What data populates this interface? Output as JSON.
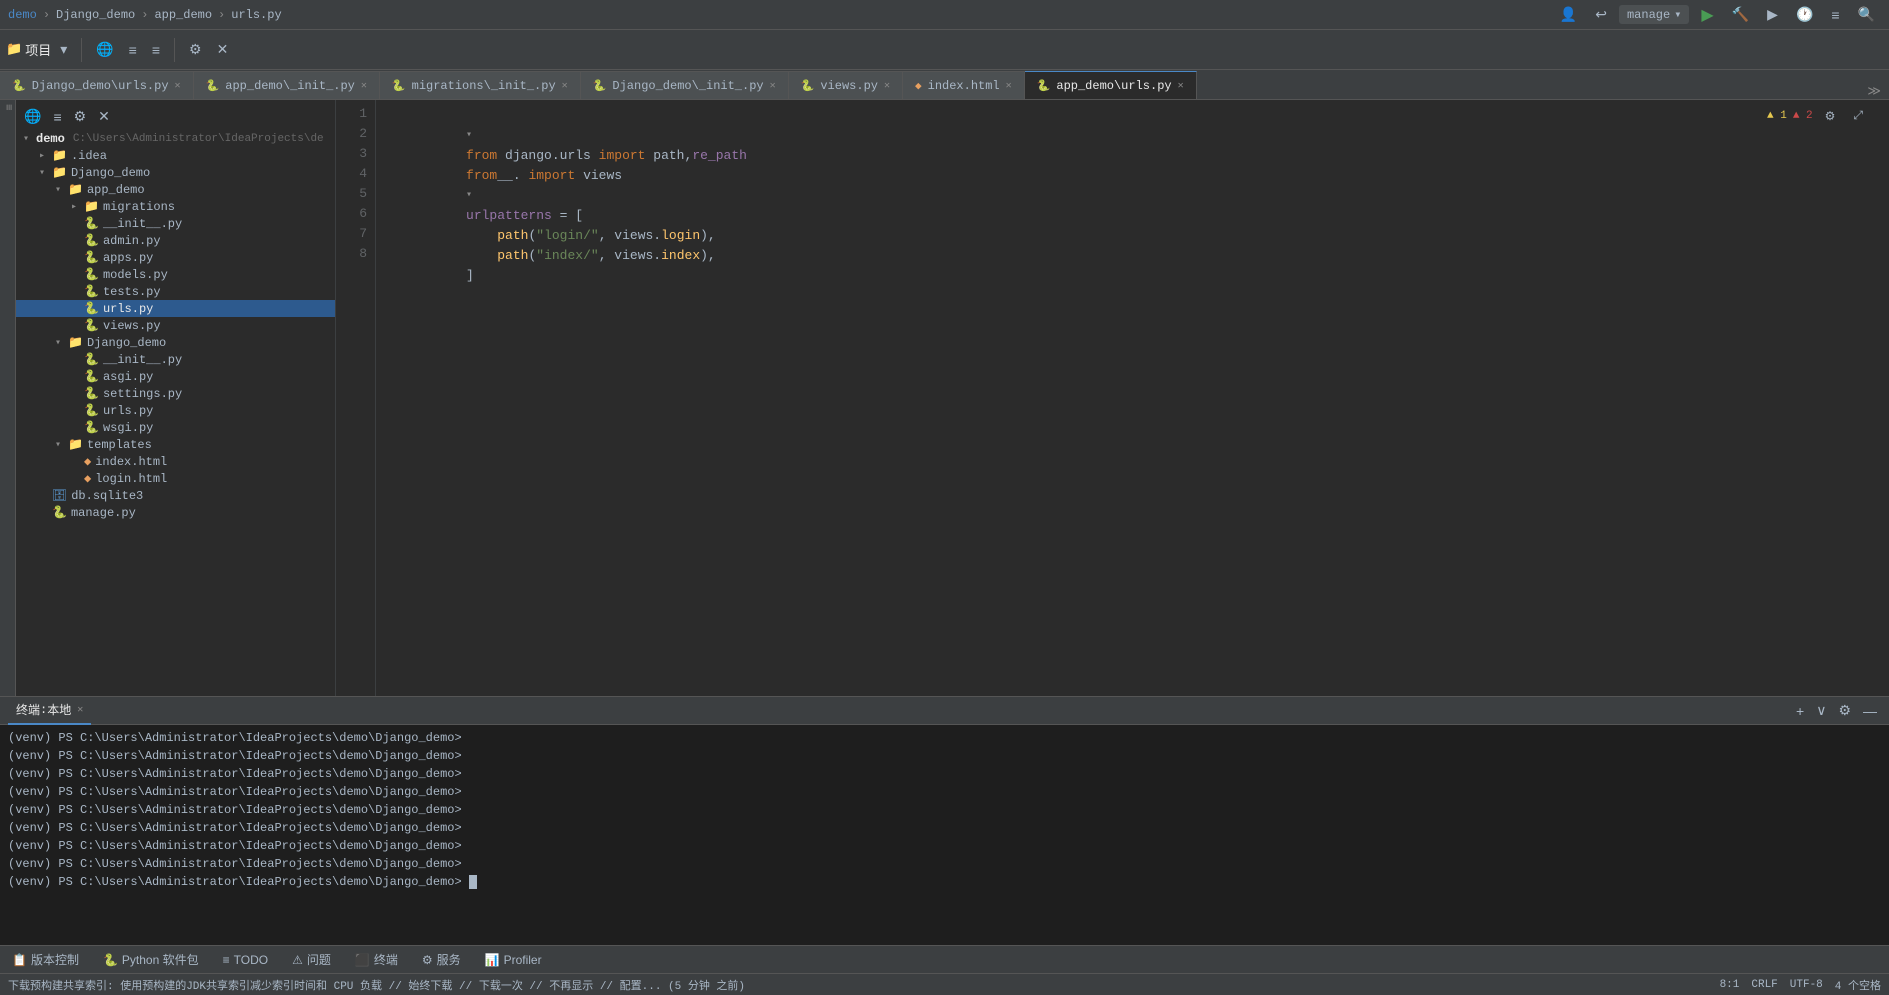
{
  "titlebar": {
    "breadcrumb": [
      "demo",
      "Django_demo",
      "app_demo",
      "urls.py"
    ],
    "manage_label": "manage",
    "search_icon": "🔍"
  },
  "toolbar": {
    "project_label": "项目",
    "run_config": "manage"
  },
  "tabs": [
    {
      "id": "django-urls",
      "icon": "py",
      "label": "Django_demo\\urls.py",
      "active": false
    },
    {
      "id": "app-init",
      "icon": "py",
      "label": "app_demo\\_init_.py",
      "active": false
    },
    {
      "id": "migrations-init",
      "icon": "py",
      "label": "migrations\\_init_.py",
      "active": false
    },
    {
      "id": "django-init",
      "icon": "py",
      "label": "Django_demo\\_init_.py",
      "active": false
    },
    {
      "id": "views",
      "icon": "py",
      "label": "views.py",
      "active": false
    },
    {
      "id": "index-html",
      "icon": "html",
      "label": "index.html",
      "active": false
    },
    {
      "id": "app-urls",
      "icon": "py",
      "label": "app_demo\\urls.py",
      "active": true
    }
  ],
  "file_tree": {
    "root": "demo",
    "root_path": "C:\\Users\\Administrator\\IdeaProjects\\de",
    "items": [
      {
        "id": "idea",
        "level": 1,
        "type": "folder",
        "label": ".idea",
        "expanded": false
      },
      {
        "id": "django-demo",
        "level": 1,
        "type": "folder",
        "label": "Django_demo",
        "expanded": true
      },
      {
        "id": "app-demo",
        "level": 2,
        "type": "folder",
        "label": "app_demo",
        "expanded": true
      },
      {
        "id": "migrations",
        "level": 3,
        "type": "folder",
        "label": "migrations",
        "expanded": false
      },
      {
        "id": "app-init-py",
        "level": 3,
        "type": "py",
        "label": "__init__.py"
      },
      {
        "id": "admin-py",
        "level": 3,
        "type": "py",
        "label": "admin.py"
      },
      {
        "id": "apps-py",
        "level": 3,
        "type": "py",
        "label": "apps.py"
      },
      {
        "id": "models-py",
        "level": 3,
        "type": "py",
        "label": "models.py"
      },
      {
        "id": "tests-py",
        "level": 3,
        "type": "py",
        "label": "tests.py"
      },
      {
        "id": "urls-py",
        "level": 3,
        "type": "py",
        "label": "urls.py",
        "selected": true
      },
      {
        "id": "views-py",
        "level": 3,
        "type": "py",
        "label": "views.py"
      },
      {
        "id": "django-demo-folder",
        "level": 2,
        "type": "folder",
        "label": "Django_demo",
        "expanded": true
      },
      {
        "id": "dj-init-py",
        "level": 3,
        "type": "py",
        "label": "__init__.py"
      },
      {
        "id": "asgi-py",
        "level": 3,
        "type": "py",
        "label": "asgi.py"
      },
      {
        "id": "settings-py",
        "level": 3,
        "type": "py",
        "label": "settings.py"
      },
      {
        "id": "dj-urls-py",
        "level": 3,
        "type": "py",
        "label": "urls.py"
      },
      {
        "id": "wsgi-py",
        "level": 3,
        "type": "py",
        "label": "wsgi.py"
      },
      {
        "id": "templates",
        "level": 2,
        "type": "folder",
        "label": "templates",
        "expanded": true
      },
      {
        "id": "index-html-file",
        "level": 3,
        "type": "html",
        "label": "index.html"
      },
      {
        "id": "login-html-file",
        "level": 3,
        "type": "html",
        "label": "login.html"
      },
      {
        "id": "db-sqlite",
        "level": 1,
        "type": "db",
        "label": "db.sqlite3"
      },
      {
        "id": "manage-py",
        "level": 1,
        "type": "py",
        "label": "manage.py"
      }
    ]
  },
  "editor": {
    "filename": "urls.py",
    "warnings": "▲ 1",
    "errors": "▲ 2",
    "lines": [
      {
        "num": 1,
        "content": "from django.urls import path, re_path",
        "tokens": [
          {
            "text": "from ",
            "class": "kw"
          },
          {
            "text": "django.urls",
            "class": "imp"
          },
          {
            "text": " import ",
            "class": "kw"
          },
          {
            "text": "path, re_path",
            "class": "imp"
          }
        ]
      },
      {
        "num": 2,
        "content": "from__. import views",
        "tokens": [
          {
            "text": "from",
            "class": "kw"
          },
          {
            "text": "__.",
            "class": "imp"
          },
          {
            "text": " import ",
            "class": "kw"
          },
          {
            "text": "views",
            "class": "imp"
          }
        ]
      },
      {
        "num": 3,
        "content": ""
      },
      {
        "num": 4,
        "content": "urlpatterns = [",
        "tokens": [
          {
            "text": "urlpatterns",
            "class": "var"
          },
          {
            "text": " = [",
            "class": "op"
          }
        ]
      },
      {
        "num": 5,
        "content": "    path(\"login/\", views.login),",
        "tokens": [
          {
            "text": "    "
          },
          {
            "text": "path",
            "class": "fn"
          },
          {
            "text": "(",
            "class": "op"
          },
          {
            "text": "\"login/\"",
            "class": "str"
          },
          {
            "text": ", views.",
            "class": "imp"
          },
          {
            "text": "login",
            "class": "fn"
          },
          {
            "text": "),",
            "class": "op"
          }
        ]
      },
      {
        "num": 6,
        "content": "    path(\"index/\", views.index),",
        "tokens": [
          {
            "text": "    "
          },
          {
            "text": "path",
            "class": "fn"
          },
          {
            "text": "(",
            "class": "op"
          },
          {
            "text": "\"index/\"",
            "class": "str"
          },
          {
            "text": ", views.",
            "class": "imp"
          },
          {
            "text": "index",
            "class": "fn"
          },
          {
            "text": "),",
            "class": "op"
          }
        ]
      },
      {
        "num": 7,
        "content": "]"
      },
      {
        "num": 8,
        "content": ""
      }
    ]
  },
  "terminal": {
    "tab_label": "终端",
    "local_label": "本地",
    "lines": [
      "(venv) PS C:\\Users\\Administrator\\IdeaProjects\\demo\\Django_demo>",
      "(venv) PS C:\\Users\\Administrator\\IdeaProjects\\demo\\Django_demo>",
      "(venv) PS C:\\Users\\Administrator\\IdeaProjects\\demo\\Django_demo>",
      "(venv) PS C:\\Users\\Administrator\\IdeaProjects\\demo\\Django_demo>",
      "(venv) PS C:\\Users\\Administrator\\IdeaProjects\\demo\\Django_demo>",
      "(venv) PS C:\\Users\\Administrator\\IdeaProjects\\demo\\Django_demo>",
      "(venv) PS C:\\Users\\Administrator\\IdeaProjects\\demo\\Django_demo>",
      "(venv) PS C:\\Users\\Administrator\\IdeaProjects\\demo\\Django_demo>",
      "(venv) PS C:\\Users\\Administrator\\IdeaProjects\\demo\\Django_demo>"
    ]
  },
  "status_bar": {
    "notification": "下载预构建共享索引: 使用预构建的JDK共享索引减少索引时间和 CPU 负载 // 始终下载 // 下载一次 // 不再显示 // 配置... (5 分钟 之前)",
    "position": "8:1",
    "line_sep": "CRLF",
    "encoding": "UTF-8",
    "indent": "4 个空格"
  },
  "bottom_toolbar": {
    "items": [
      {
        "icon": "📋",
        "label": "版本控制"
      },
      {
        "icon": "🐍",
        "label": "Python 软件包"
      },
      {
        "icon": "≡",
        "label": "TODO"
      },
      {
        "icon": "⚠",
        "label": "问题"
      },
      {
        "icon": "⬛",
        "label": "终端"
      },
      {
        "icon": "⚙",
        "label": "服务"
      },
      {
        "icon": "📊",
        "label": "Profiler"
      }
    ]
  }
}
